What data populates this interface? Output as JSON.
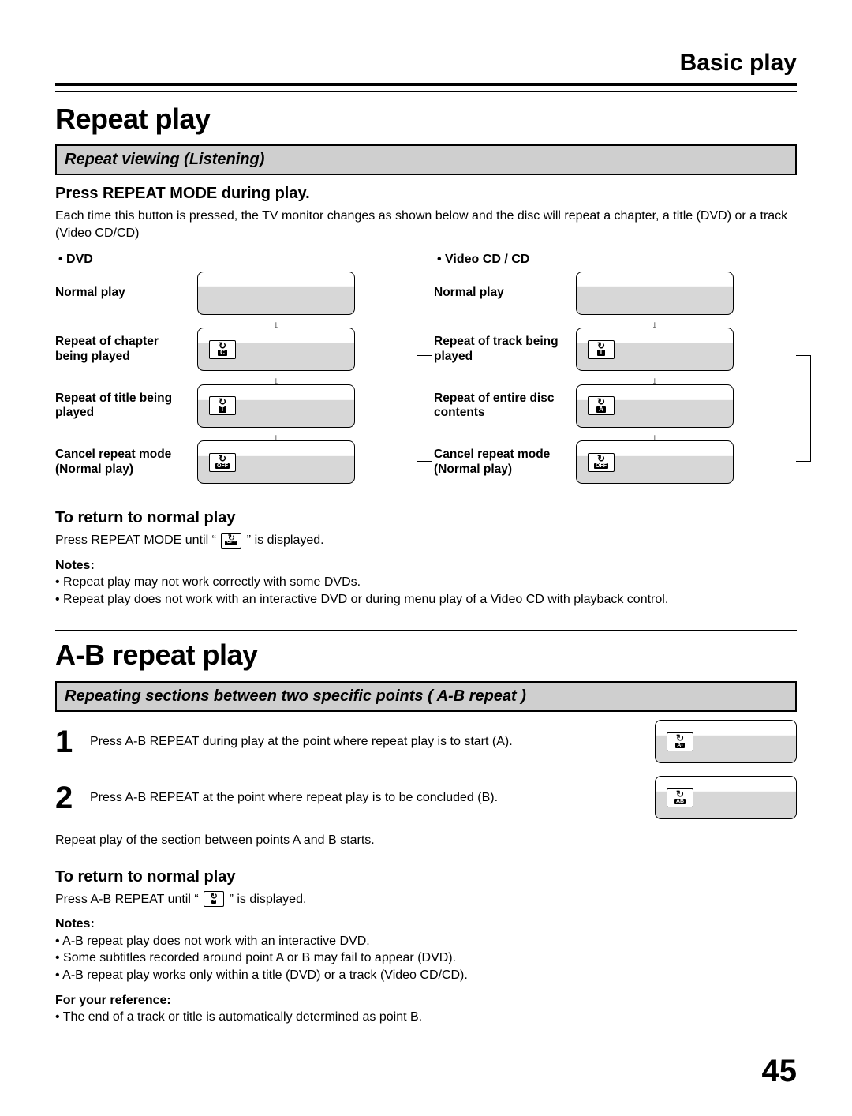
{
  "header": {
    "section_title": "Basic play"
  },
  "repeat": {
    "title": "Repeat play",
    "bar": "Repeat viewing (Listening)",
    "instruction": "Press REPEAT MODE during play.",
    "description": "Each time this button is pressed, the TV monitor changes as shown below and the disc will repeat a chapter, a title (DVD) or a track (Video CD/CD)",
    "dvd": {
      "head": "• DVD",
      "rows": [
        {
          "label": "Normal play",
          "icon": null
        },
        {
          "label": "Repeat of chapter being played",
          "icon": "C"
        },
        {
          "label": "Repeat of title being played",
          "icon": "T"
        },
        {
          "label": "Cancel repeat mode (Normal play)",
          "icon": "OFF"
        }
      ]
    },
    "vcd": {
      "head": "• Video CD / CD",
      "rows": [
        {
          "label": "Normal play",
          "icon": null
        },
        {
          "label": "Repeat of track being played",
          "icon": "T"
        },
        {
          "label": "Repeat of entire disc contents",
          "icon": "A"
        },
        {
          "label": "Cancel repeat mode (Normal play)",
          "icon": "OFF"
        }
      ]
    },
    "return_head": "To return to normal play",
    "return_text_pre": "Press REPEAT MODE until “ ",
    "return_text_post": " ” is displayed.",
    "return_icon": "OFF",
    "notes_head": "Notes:",
    "notes": [
      "Repeat play may not work correctly with some DVDs.",
      "Repeat play does not work with an interactive DVD or during menu play of a Video CD with playback control."
    ]
  },
  "ab": {
    "title": "A-B repeat play",
    "bar": "Repeating sections between two specific points ( A-B repeat )",
    "steps": [
      {
        "num": "1",
        "text": "Press A-B REPEAT during play at the point where repeat play is to start (A).",
        "icon": "A-"
      },
      {
        "num": "2",
        "text": "Press A-B REPEAT at the point where repeat play is to be concluded (B).",
        "icon": "AB"
      }
    ],
    "after_steps": "Repeat play of the section between points A and B starts.",
    "return_head": "To return to normal play",
    "return_text_pre": "Press A-B REPEAT until “ ",
    "return_text_post": " ” is displayed.",
    "return_icon": "•",
    "notes_head": "Notes:",
    "notes": [
      "A-B repeat play does not work with an interactive DVD.",
      "Some subtitles recorded around point A or B may fail to appear (DVD).",
      "A-B repeat play works only within a title (DVD) or a track (Video CD/CD)."
    ],
    "ref_head": "For your reference:",
    "ref_notes": [
      "The end of a track or title is automatically determined as point B."
    ]
  },
  "page_number": "45"
}
